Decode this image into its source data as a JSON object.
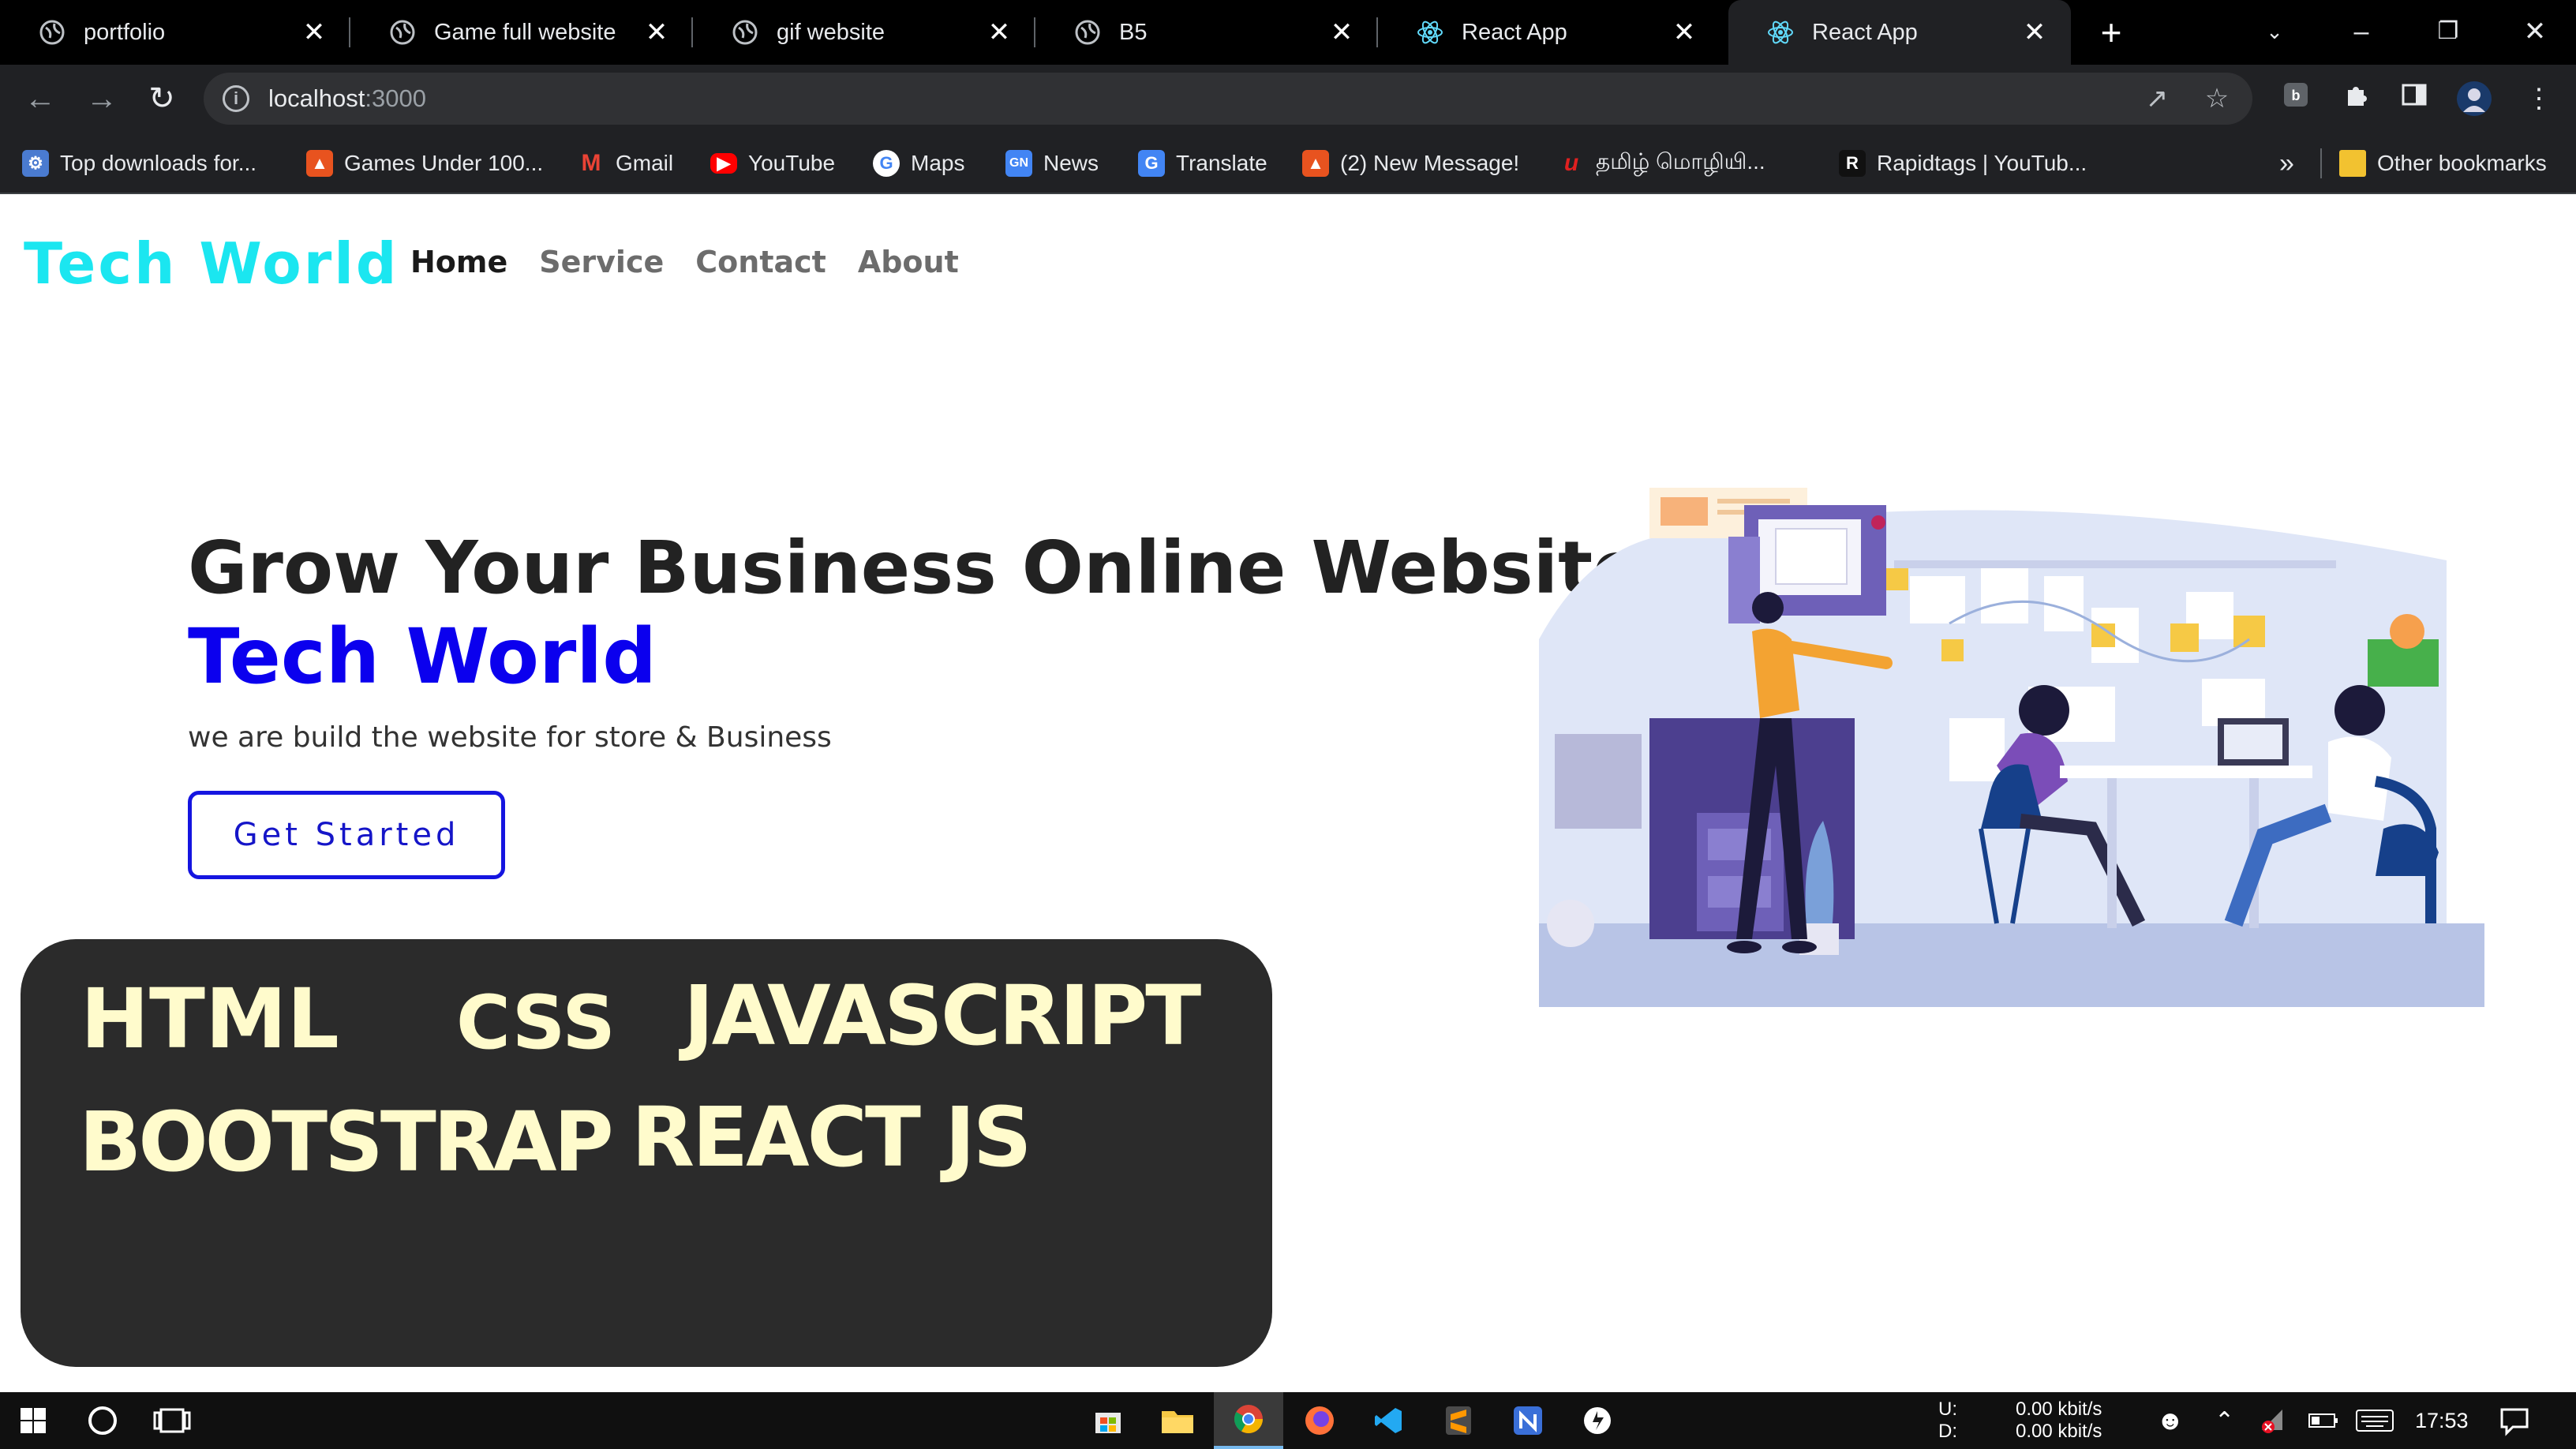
{
  "browser": {
    "tabs": [
      {
        "title": "portfolio",
        "icon": "globe-icon"
      },
      {
        "title": "Game full website",
        "icon": "globe-icon"
      },
      {
        "title": "gif website",
        "icon": "globe-icon"
      },
      {
        "title": "B5",
        "icon": "globe-icon"
      },
      {
        "title": "React App",
        "icon": "react-icon"
      },
      {
        "title": "React App",
        "icon": "react-icon",
        "active": true
      }
    ],
    "close_glyph": "✕",
    "new_tab_glyph": "+",
    "url_host": "localhost",
    "url_port": ":3000",
    "bookmarks": [
      {
        "label": "Top downloads for...",
        "icon": "download-site-icon",
        "color": "#4a7bd0"
      },
      {
        "label": "Games Under 100...",
        "icon": "brave-icon",
        "color": "#e8531f"
      },
      {
        "label": "Gmail",
        "icon": "gmail-icon",
        "color": "#ea4335"
      },
      {
        "label": "YouTube",
        "icon": "youtube-icon",
        "color": "#ff0000"
      },
      {
        "label": "Maps",
        "icon": "google-icon",
        "color": "#4285f4"
      },
      {
        "label": "News",
        "icon": "news-icon",
        "color": "#4285f4"
      },
      {
        "label": "Translate",
        "icon": "translate-icon",
        "color": "#4285f4"
      },
      {
        "label": "(2) New Message!",
        "icon": "brave-icon",
        "color": "#e8531f"
      },
      {
        "label": "தமிழ் மொழியி...",
        "icon": "tamil-site-icon",
        "color": "#e02020"
      },
      {
        "label": "Rapidtags | YouTub...",
        "icon": "rapidtags-icon",
        "color": "#111111"
      }
    ],
    "overflow_glyph": "»",
    "other_bookmarks": "Other bookmarks"
  },
  "site": {
    "brand": "Tech World",
    "nav": [
      {
        "label": "Home",
        "active": true
      },
      {
        "label": "Service"
      },
      {
        "label": "Contact"
      },
      {
        "label": "About"
      }
    ],
    "hero": {
      "title": "Grow Your Business Online Website",
      "brand_line": "Tech World",
      "subtitle": "we are build the website for store & Business",
      "cta": "Get Started"
    },
    "skills": [
      "HTML",
      "CSS",
      "JAVASCRIPT",
      "BOOTSTRAP",
      "REACT JS"
    ],
    "colors": {
      "brand": "#1be6f0",
      "hero_brand": "#0b00ee",
      "cta_border": "#1515e0",
      "skills_bg": "#2b2b2b",
      "skills_text": "#fffbcc"
    }
  },
  "taskbar": {
    "net_up_label": "U:",
    "net_down_label": "D:",
    "net_up": "0.00 kbit/s",
    "net_down": "0.00 kbit/s",
    "time": "17:53"
  }
}
